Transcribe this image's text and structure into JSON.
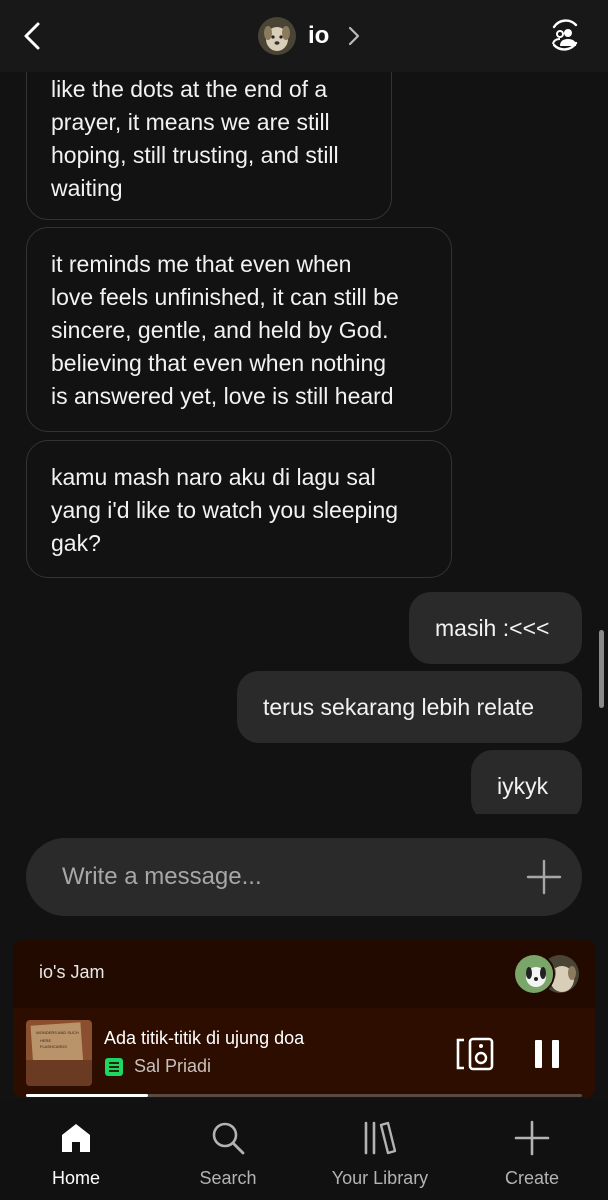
{
  "header": {
    "title": "io"
  },
  "messages": [
    {
      "from": "them",
      "lines": [
        "like the dots at the end of a",
        "prayer, it means we are still",
        "hoping, still trusting, and still",
        "waiting"
      ]
    },
    {
      "from": "them",
      "lines": [
        "it reminds me that even when",
        "love feels unfinished, it can still be",
        "sincere, gentle, and held by God.",
        "believing that even when nothing",
        "is answered yet, love is still heard"
      ]
    },
    {
      "from": "them",
      "lines": [
        "kamu mash naro aku di lagu sal",
        "yang i'd like to watch you sleeping",
        "gak?"
      ]
    },
    {
      "from": "me",
      "lines": [
        "masih :<<<"
      ]
    },
    {
      "from": "me",
      "lines": [
        "terus sekarang lebih relate"
      ]
    },
    {
      "from": "me",
      "lines": [
        "iykyk"
      ]
    }
  ],
  "composer": {
    "placeholder": "Write a message..."
  },
  "now_playing": {
    "jam_label": "io's Jam",
    "track": "Ada titik-titik di ujung doa",
    "artist": "Sal Priadi",
    "progress": 0.22,
    "art_text": [
      "WONDERS AND SUCH",
      "HERE",
      "FLASHCARDS"
    ]
  },
  "nav": {
    "items": [
      {
        "label": "Home",
        "active": true
      },
      {
        "label": "Search",
        "active": false
      },
      {
        "label": "Your Library",
        "active": false
      },
      {
        "label": "Create",
        "active": false
      }
    ]
  },
  "colors": {
    "background": "#121212",
    "bubble_out": "#2a2a2a",
    "jam_card": "#2c0d00",
    "spotify_green": "#1ed760"
  }
}
